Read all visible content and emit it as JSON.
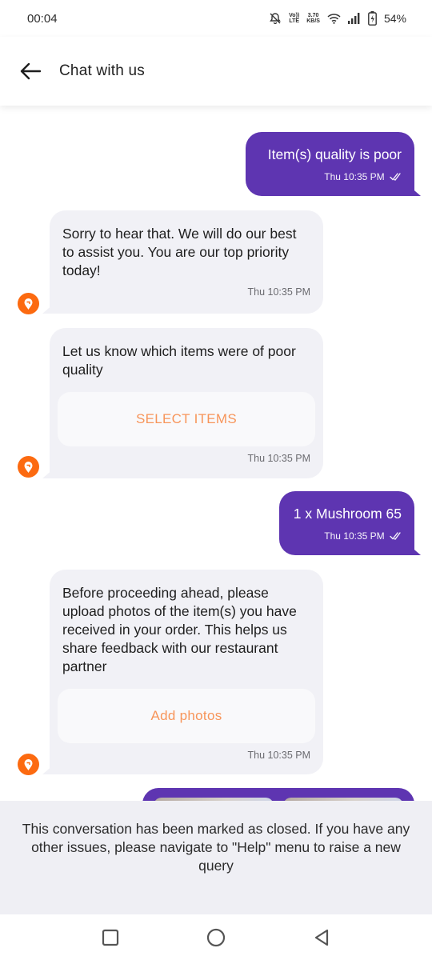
{
  "status_bar": {
    "time": "00:04",
    "volte_top": "Vo))",
    "volte_bottom": "LTE",
    "speed_top": "3.70",
    "speed_bottom": "KB/S",
    "battery_percent": "54%"
  },
  "header": {
    "title": "Chat with us"
  },
  "messages": [
    {
      "side": "out",
      "text": "Item(s) quality is poor",
      "time": "Thu 10:35 PM"
    },
    {
      "side": "in",
      "text": "Sorry to hear that. We will do our best to assist you. You are our top priority today!",
      "time": "Thu 10:35 PM"
    },
    {
      "side": "in",
      "text": "Let us know which items were of poor quality",
      "action": "SELECT ITEMS",
      "time": "Thu 10:35 PM"
    },
    {
      "side": "out",
      "text": "1 x Mushroom 65",
      "time": "Thu 10:35 PM"
    },
    {
      "side": "in",
      "text": "Before proceeding ahead, please upload photos of the item(s) you have received in your order. This helps us share feedback with our restaurant partner",
      "action": "Add photos",
      "time": "Thu 10:35 PM"
    }
  ],
  "closed_banner": {
    "text": "This conversation has been marked as closed. If you have any other issues, please navigate to \"Help\" menu to raise a new query"
  },
  "colors": {
    "outgoing_bubble": "#5e35b1",
    "incoming_bubble": "#f1f1f6",
    "accent_orange": "#fc6a10",
    "action_text": "#f7955a"
  },
  "icons": {
    "back": "arrow-left-icon",
    "avatar": "swiggy-logo-icon",
    "read_receipt": "double-check-icon"
  }
}
